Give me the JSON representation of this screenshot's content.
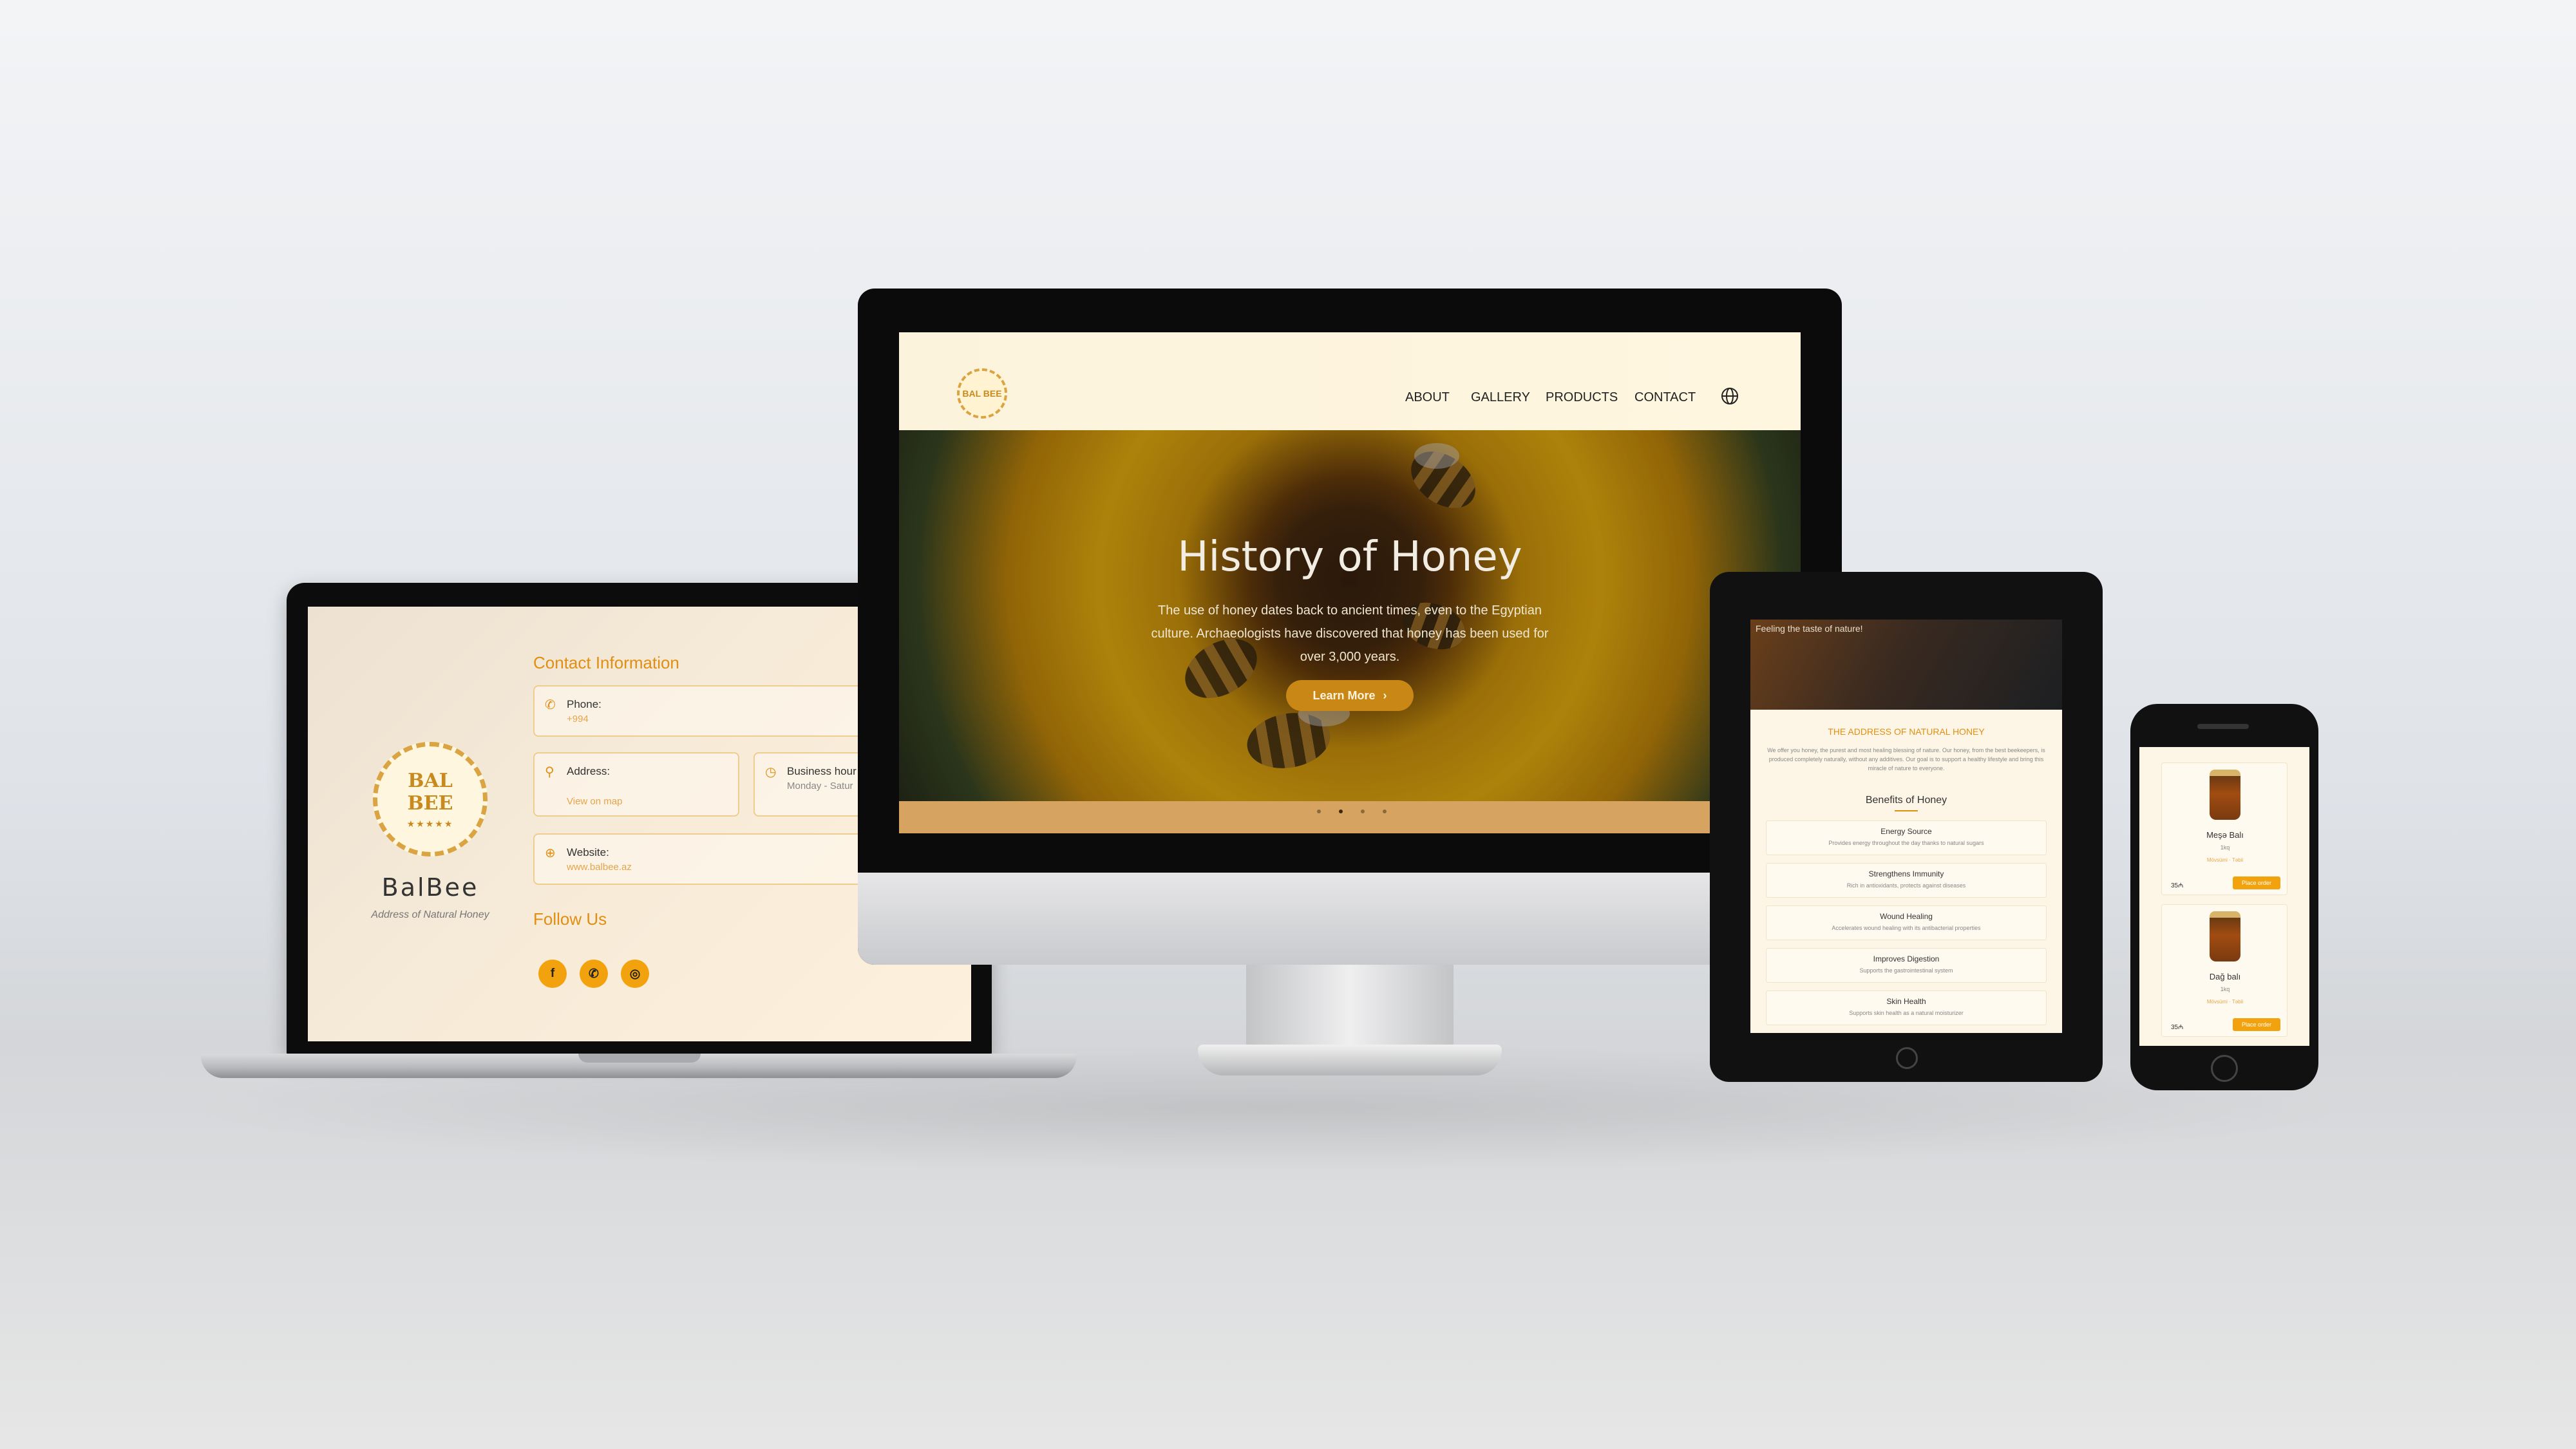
{
  "colors": {
    "accent": "#e08f12",
    "button": "#f2a20d",
    "cream": "#fdf3d8",
    "hero_button": "#c98815"
  },
  "laptop": {
    "brand": "BalBee",
    "tagline": "Address of Natural Honey",
    "logo_line1": "BAL",
    "logo_line2": "BEE",
    "logo_stars": "★★★★★",
    "contact_heading": "Contact Information",
    "phone_label": "Phone:",
    "phone_value": "+994",
    "address_label": "Address:",
    "address_link": "View on map",
    "hours_label": "Business hour",
    "hours_value": "Monday - Satur",
    "website_label": "Website:",
    "website_value": "www.balbee.az",
    "follow_heading": "Follow Us",
    "social": [
      {
        "icon": "facebook-icon",
        "glyph": "f"
      },
      {
        "icon": "whatsapp-icon",
        "glyph": "✆"
      },
      {
        "icon": "instagram-icon",
        "glyph": "◎"
      }
    ]
  },
  "monitor": {
    "logo_text": "BAL BEE",
    "nav": [
      "ABOUT",
      "GALLERY",
      "PRODUCTS",
      "CONTACT"
    ],
    "hero_title": "History of Honey",
    "hero_text": "The use of honey dates back to ancient times, even to the Egyptian culture. Archaeologists have discovered that honey has been used for over 3,000 years.",
    "hero_button": "Learn More",
    "hero_button_icon": "›"
  },
  "tablet": {
    "hero_text": "Feeling the taste of nature!",
    "heading": "THE ADDRESS OF NATURAL HONEY",
    "paragraph": "We offer you honey, the purest and most healing blessing of nature. Our honey, from the best beekeepers, is produced completely naturally, without any additives. Our goal is to support a healthy lifestyle and bring this miracle of nature to everyone.",
    "benefits_heading": "Benefits of Honey",
    "benefits": [
      {
        "title": "Energy Source",
        "text": "Provides energy throughout the day thanks to natural sugars"
      },
      {
        "title": "Strengthens Immunity",
        "text": "Rich in antioxidants, protects against diseases"
      },
      {
        "title": "Wound Healing",
        "text": "Accelerates wound healing with its antibacterial properties"
      },
      {
        "title": "Improves Digestion",
        "text": "Supports the gastrointestinal system"
      },
      {
        "title": "Skin Health",
        "text": "Supports skin health as a natural moisturizer"
      }
    ]
  },
  "phone": {
    "products": [
      {
        "name": "Meşə Balı",
        "sub": "1kq",
        "tags": "Mövsümi · Təbii",
        "price": "35₼",
        "button": "Place order"
      },
      {
        "name": "Dağ balı",
        "sub": "1kq",
        "tags": "Mövsümi · Təbii",
        "price": "35₼",
        "button": "Place order"
      }
    ]
  }
}
